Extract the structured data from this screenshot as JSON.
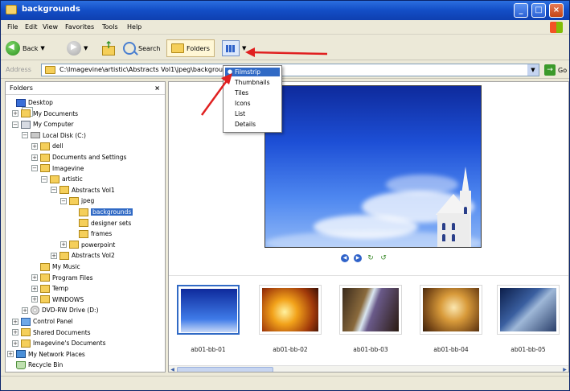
{
  "window": {
    "title": "backgrounds"
  },
  "menu": {
    "items": [
      "File",
      "Edit",
      "View",
      "Favorites",
      "Tools",
      "Help"
    ]
  },
  "toolbar": {
    "back_label": "Back",
    "search_label": "Search",
    "folders_label": "Folders"
  },
  "address": {
    "label": "Address",
    "value": "C:\\Imagevine\\artistic\\Abstracts Vol1\\jpeg\\backgrounds",
    "go_label": "Go"
  },
  "views_menu": {
    "items": [
      "Filmstrip",
      "Thumbnails",
      "Tiles",
      "Icons",
      "List",
      "Details"
    ],
    "selected": "Filmstrip"
  },
  "folders_pane": {
    "title": "Folders",
    "close_glyph": "×",
    "tree": [
      {
        "label": "Desktop",
        "icon": "desktop-icon",
        "expander": ""
      },
      {
        "label": "My Documents",
        "icon": "documents-folder-icon",
        "expander": "+"
      },
      {
        "label": "My Computer",
        "icon": "computer-icon",
        "expander": "−"
      },
      {
        "label": "Local Disk (C:)",
        "icon": "drive-icon",
        "expander": "−"
      },
      {
        "label": "dell",
        "icon": "folder-icon",
        "expander": "+"
      },
      {
        "label": "Documents and Settings",
        "icon": "folder-icon",
        "expander": "+"
      },
      {
        "label": "Imagevine",
        "icon": "folder-icon",
        "expander": "−"
      },
      {
        "label": "artistic",
        "icon": "folder-icon",
        "expander": "−"
      },
      {
        "label": "Abstracts Vol1",
        "icon": "folder-icon",
        "expander": "−"
      },
      {
        "label": "jpeg",
        "icon": "folder-icon",
        "expander": "−"
      },
      {
        "label": "backgrounds",
        "icon": "folder-icon",
        "expander": ""
      },
      {
        "label": "designer sets",
        "icon": "folder-icon",
        "expander": ""
      },
      {
        "label": "frames",
        "icon": "folder-icon",
        "expander": ""
      },
      {
        "label": "powerpoint",
        "icon": "folder-icon",
        "expander": "+"
      },
      {
        "label": "Abstracts Vol2",
        "icon": "folder-icon",
        "expander": "+"
      },
      {
        "label": "My Music",
        "icon": "folder-icon",
        "expander": ""
      },
      {
        "label": "Program Files",
        "icon": "folder-icon",
        "expander": "+"
      },
      {
        "label": "Temp",
        "icon": "folder-icon",
        "expander": "+"
      },
      {
        "label": "WINDOWS",
        "icon": "folder-icon",
        "expander": "+"
      },
      {
        "label": "DVD-RW Drive (D:)",
        "icon": "cd-drive-icon",
        "expander": "+"
      },
      {
        "label": "Control Panel",
        "icon": "control-panel-icon",
        "expander": "+"
      },
      {
        "label": "Shared Documents",
        "icon": "folder-icon",
        "expander": "+"
      },
      {
        "label": "Imagevine's Documents",
        "icon": "folder-icon",
        "expander": "+"
      },
      {
        "label": "My Network Places",
        "icon": "network-icon",
        "expander": "+"
      },
      {
        "label": "Recycle Bin",
        "icon": "recycle-bin-icon",
        "expander": ""
      }
    ],
    "selected": "backgrounds"
  },
  "filmstrip": {
    "thumbnails": [
      {
        "caption": "ab01-bb-01"
      },
      {
        "caption": "ab01-bb-02"
      },
      {
        "caption": "ab01-bb-03"
      },
      {
        "caption": "ab01-bb-04"
      },
      {
        "caption": "ab01-bb-05"
      }
    ],
    "controls": [
      "previous-image",
      "next-image",
      "rotate-clockwise",
      "rotate-counterclockwise"
    ]
  },
  "colors": {
    "titlebar": "#1450c8",
    "selection": "#316ac5",
    "annotation_arrow": "#e02020"
  }
}
